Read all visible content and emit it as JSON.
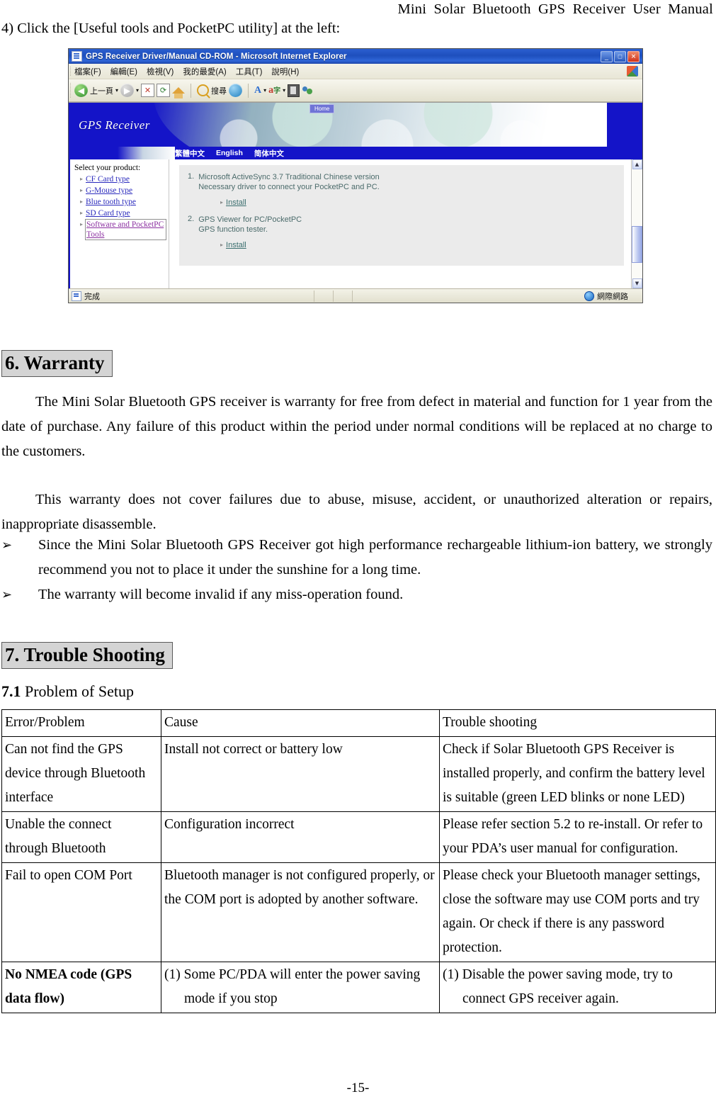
{
  "document": {
    "running_header": "Mini Solar Bluetooth GPS Receiver User Manual",
    "intro_line": "4) Click the [Useful tools and PocketPC utility] at the left:",
    "page_number": "-15-"
  },
  "figure": {
    "browser": {
      "title": "GPS Receiver Driver/Manual CD-ROM - Microsoft Internet Explorer",
      "window_buttons": {
        "minimize": "_",
        "maximize": "□",
        "close": "✕"
      },
      "menu": [
        "檔案(F)",
        "編輯(E)",
        "檢視(V)",
        "我的最愛(A)",
        "工具(T)",
        "說明(H)"
      ],
      "toolbar": {
        "back": "上一頁",
        "back_caret": "▾",
        "forward_caret": "▾",
        "search": "搜尋",
        "dropdown_caret": "▾"
      },
      "status": {
        "left": "完成",
        "right": "網際網路"
      }
    },
    "page": {
      "banner_title": "GPS Receiver",
      "home_tab": "Home",
      "languages": [
        "繁體中文",
        "English",
        "简体中文"
      ],
      "sidebar": {
        "title": "Select your product:",
        "items": [
          {
            "label": "CF Card type",
            "selected": false
          },
          {
            "label": "G-Mouse type",
            "selected": false
          },
          {
            "label": "Blue tooth type",
            "selected": false
          },
          {
            "label": "SD Card type",
            "selected": false
          },
          {
            "label": "Software and PocketPC Tools",
            "selected": true
          }
        ]
      },
      "content": {
        "items": [
          {
            "number": "1.",
            "line1": "Microsoft ActiveSync 3.7 Traditional Chinese version",
            "line2": "Necessary driver to connect your PocketPC and PC.",
            "action": "Install"
          },
          {
            "number": "2.",
            "line1": "GPS Viewer for PC/PocketPC",
            "line2": "GPS function tester.",
            "action": "Install"
          }
        ]
      }
    }
  },
  "warranty": {
    "heading": "6. Warranty",
    "paragraph1": "The Mini Solar Bluetooth GPS receiver is warranty for free from defect in material and function for 1 year from the date of purchase. Any failure of this product within the period under normal conditions will be replaced at no charge to the customers.",
    "paragraph2": "This warranty does not cover failures due to abuse, misuse, accident, or unauthorized alteration or repairs, inappropriate disassemble.",
    "bullet_char": "➢",
    "bullets": [
      "Since the Mini Solar Bluetooth GPS Receiver got high performance rechargeable lithium-ion battery, we strongly recommend you not to place it under the sunshine for a long time.",
      "The warranty will become invalid if any miss-operation found."
    ]
  },
  "trouble_shooting": {
    "heading": "7. Trouble Shooting",
    "subheading_number": "7.1",
    "subheading_text": " Problem of Setup",
    "table": {
      "headers": [
        "Error/Problem",
        "Cause",
        "Trouble shooting"
      ],
      "rows": [
        {
          "error": "Can not find the GPS device through Bluetooth interface",
          "cause": "Install not correct or battery low",
          "fix": "Check if Solar Bluetooth GPS Receiver is installed properly, and confirm the battery level is suitable (green LED blinks or none LED)",
          "bold_first": false
        },
        {
          "error": "Unable the connect through Bluetooth",
          "cause": "Configuration incorrect",
          "fix": "Please refer section 5.2 to re-install. Or refer to your PDA’s user manual for configuration.",
          "bold_first": false
        },
        {
          "error": "Fail to open COM Port",
          "cause": "Bluetooth manager is not configured properly, or the COM port is adopted by another software.",
          "fix": "Please check your Bluetooth manager settings, close the software may use COM ports and try again. Or check if there is any password protection.",
          "bold_first": false
        },
        {
          "error": "No NMEA code (GPS data flow)",
          "cause": "(1) Some PC/PDA will enter the power saving mode if you stop",
          "fix": "(1) Disable the power saving mode, try to connect GPS receiver again.",
          "bold_first": true
        }
      ]
    }
  }
}
